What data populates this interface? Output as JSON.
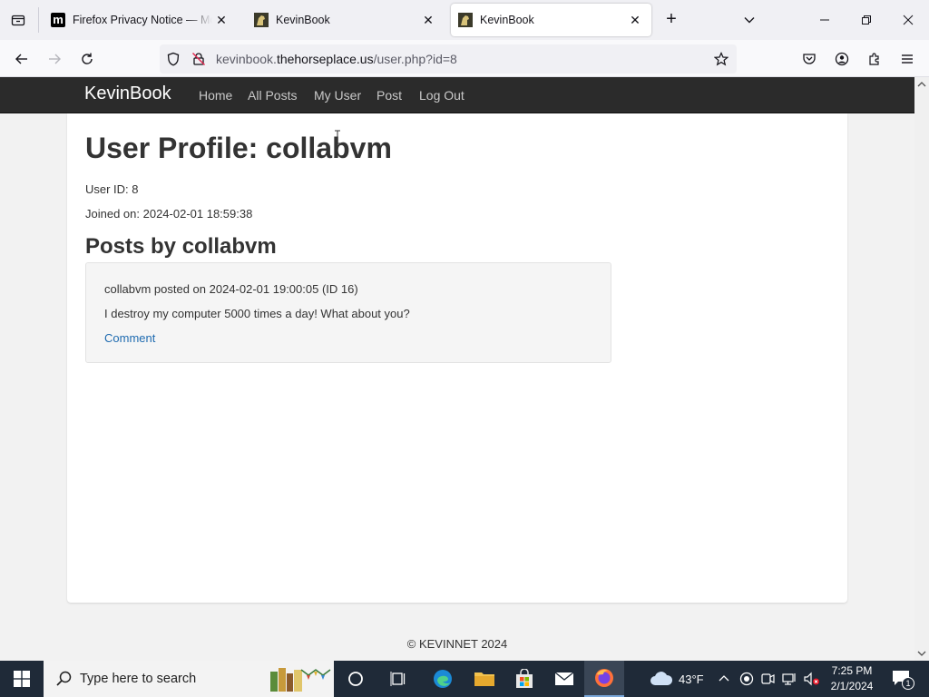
{
  "browser": {
    "tabs": [
      {
        "title": "Firefox Privacy Notice — Mozilla",
        "favicon": "mozilla-m",
        "active": false
      },
      {
        "title": "KevinBook",
        "favicon": "horse-favicon",
        "active": false
      },
      {
        "title": "KevinBook",
        "favicon": "horse-favicon",
        "active": true
      }
    ],
    "url": {
      "prefix": "kevinbook.",
      "domain": "thehorseplace.us",
      "path": "/user.php?id=8"
    }
  },
  "site": {
    "brand": "KevinBook",
    "nav": [
      "Home",
      "All Posts",
      "My User",
      "Post",
      "Log Out"
    ]
  },
  "profile": {
    "title": "User Profile: collabvm",
    "user_id": "User ID: 8",
    "joined": "Joined on: 2024-02-01 18:59:38",
    "posts_heading": "Posts by collabvm"
  },
  "posts": [
    {
      "meta": "collabvm posted on 2024-02-01 19:00:05 (ID 16)",
      "body": "I destroy my computer 5000 times a day! What about you?",
      "comment_label": "Comment"
    }
  ],
  "footer": "© KEVINNET 2024",
  "taskbar": {
    "search_placeholder": "Type here to search",
    "temperature": "43°F",
    "time": "7:25 PM",
    "date": "2/1/2024",
    "notification_count": "1"
  },
  "colors": {
    "site_nav_bg": "#2b2b2b",
    "link": "#1f6bb0",
    "taskbar_bg": "#1f2a38"
  }
}
